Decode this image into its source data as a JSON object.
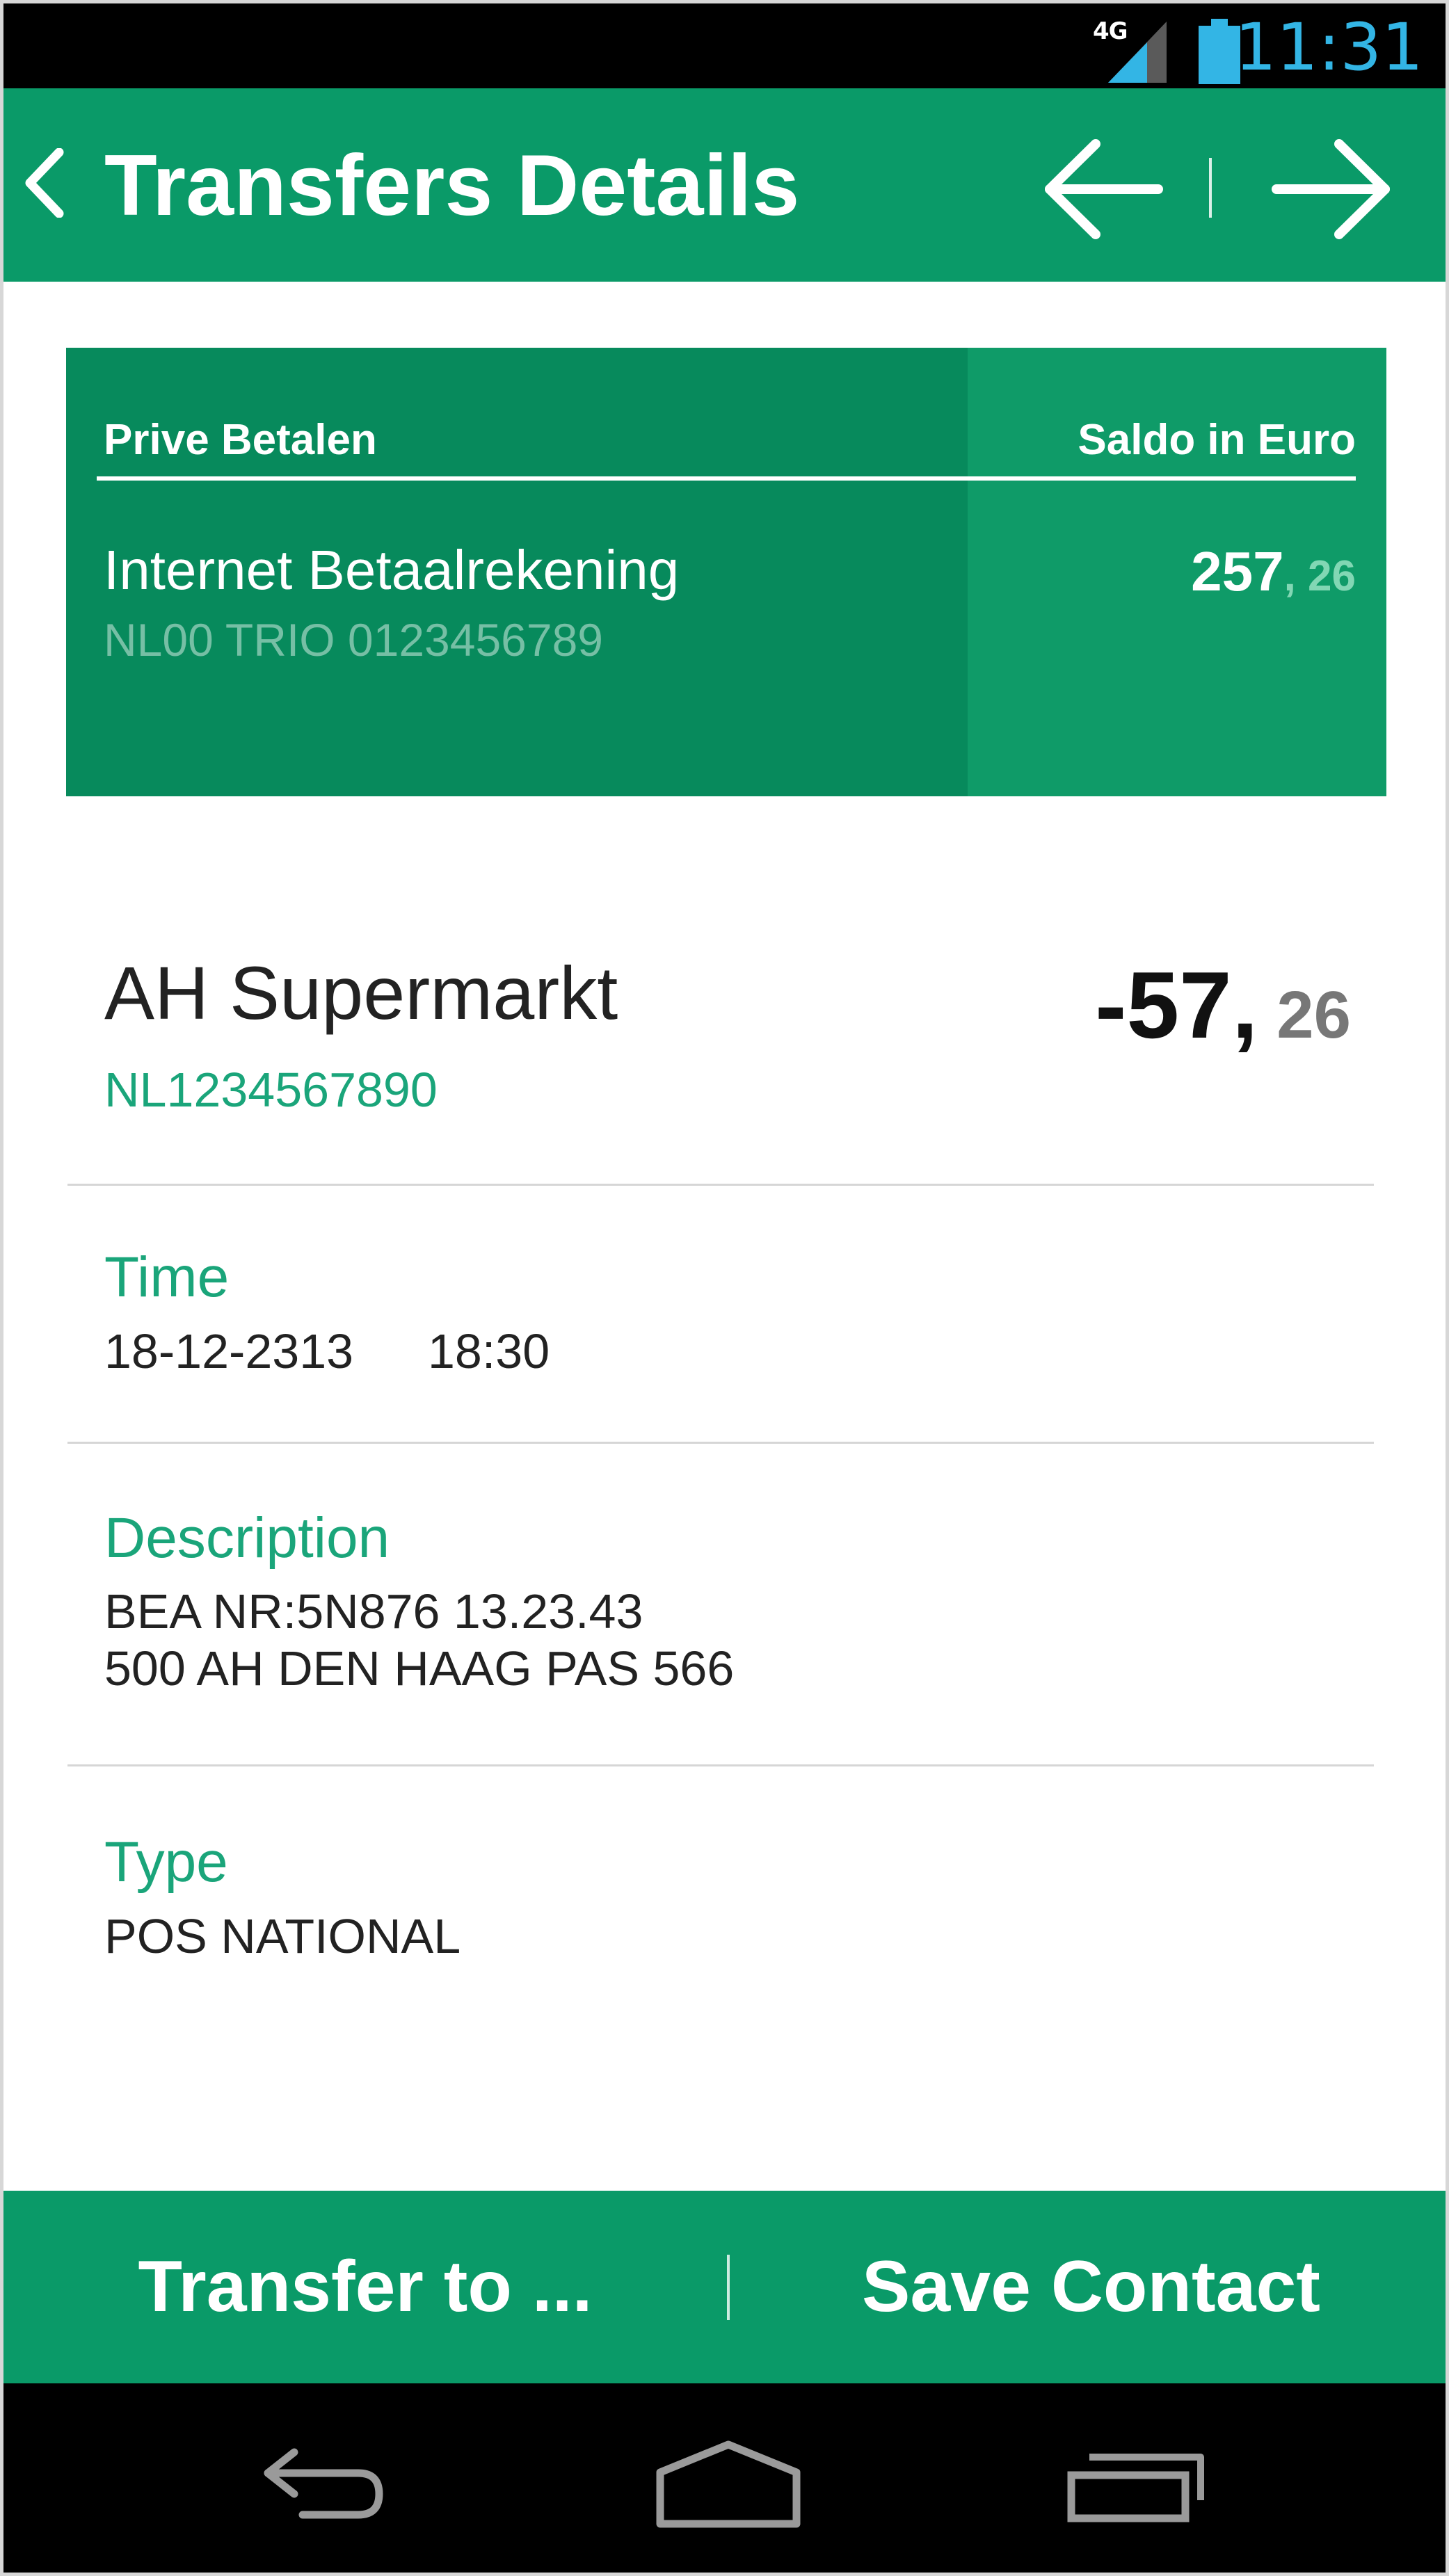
{
  "status_bar": {
    "network": "4G",
    "clock": "11:31",
    "icons": [
      "signal-icon",
      "battery-icon"
    ]
  },
  "app_bar": {
    "title": "Transfers Details",
    "icons": [
      "chevron-left-icon",
      "arrow-left-icon",
      "arrow-right-icon"
    ]
  },
  "account_card": {
    "header_left": "Prive Betalen",
    "header_right": "Saldo in Euro",
    "account_name": "Internet Betaalrekening",
    "account_iban": "NL00 TRIO 0123456789",
    "balance_int": "257",
    "balance_dec": ", 26"
  },
  "transaction": {
    "merchant": "AH Supermarkt",
    "merchant_iban": "NL1234567890",
    "amount_int": "-57,",
    "amount_dec": " 26",
    "time_label": "Time",
    "time_date": "18-12-2313",
    "time_clock": "18:30",
    "description_label": "Description",
    "description_line1": "BEA NR:5N876 13.23.43",
    "description_line2": "500 AH DEN HAAG PAS 566",
    "type_label": "Type",
    "type_value": "POS NATIONAL"
  },
  "actions": {
    "transfer_label": "Transfer to ...",
    "save_contact_label": "Save Contact"
  },
  "system_nav": {
    "icons": [
      "back-icon",
      "home-icon",
      "recents-icon"
    ]
  },
  "colors": {
    "brand_green": "#0a9a68",
    "card_dark_green": "#078a5c",
    "accent_text_green": "#1aa57a",
    "clock_blue": "#33b5e5"
  }
}
